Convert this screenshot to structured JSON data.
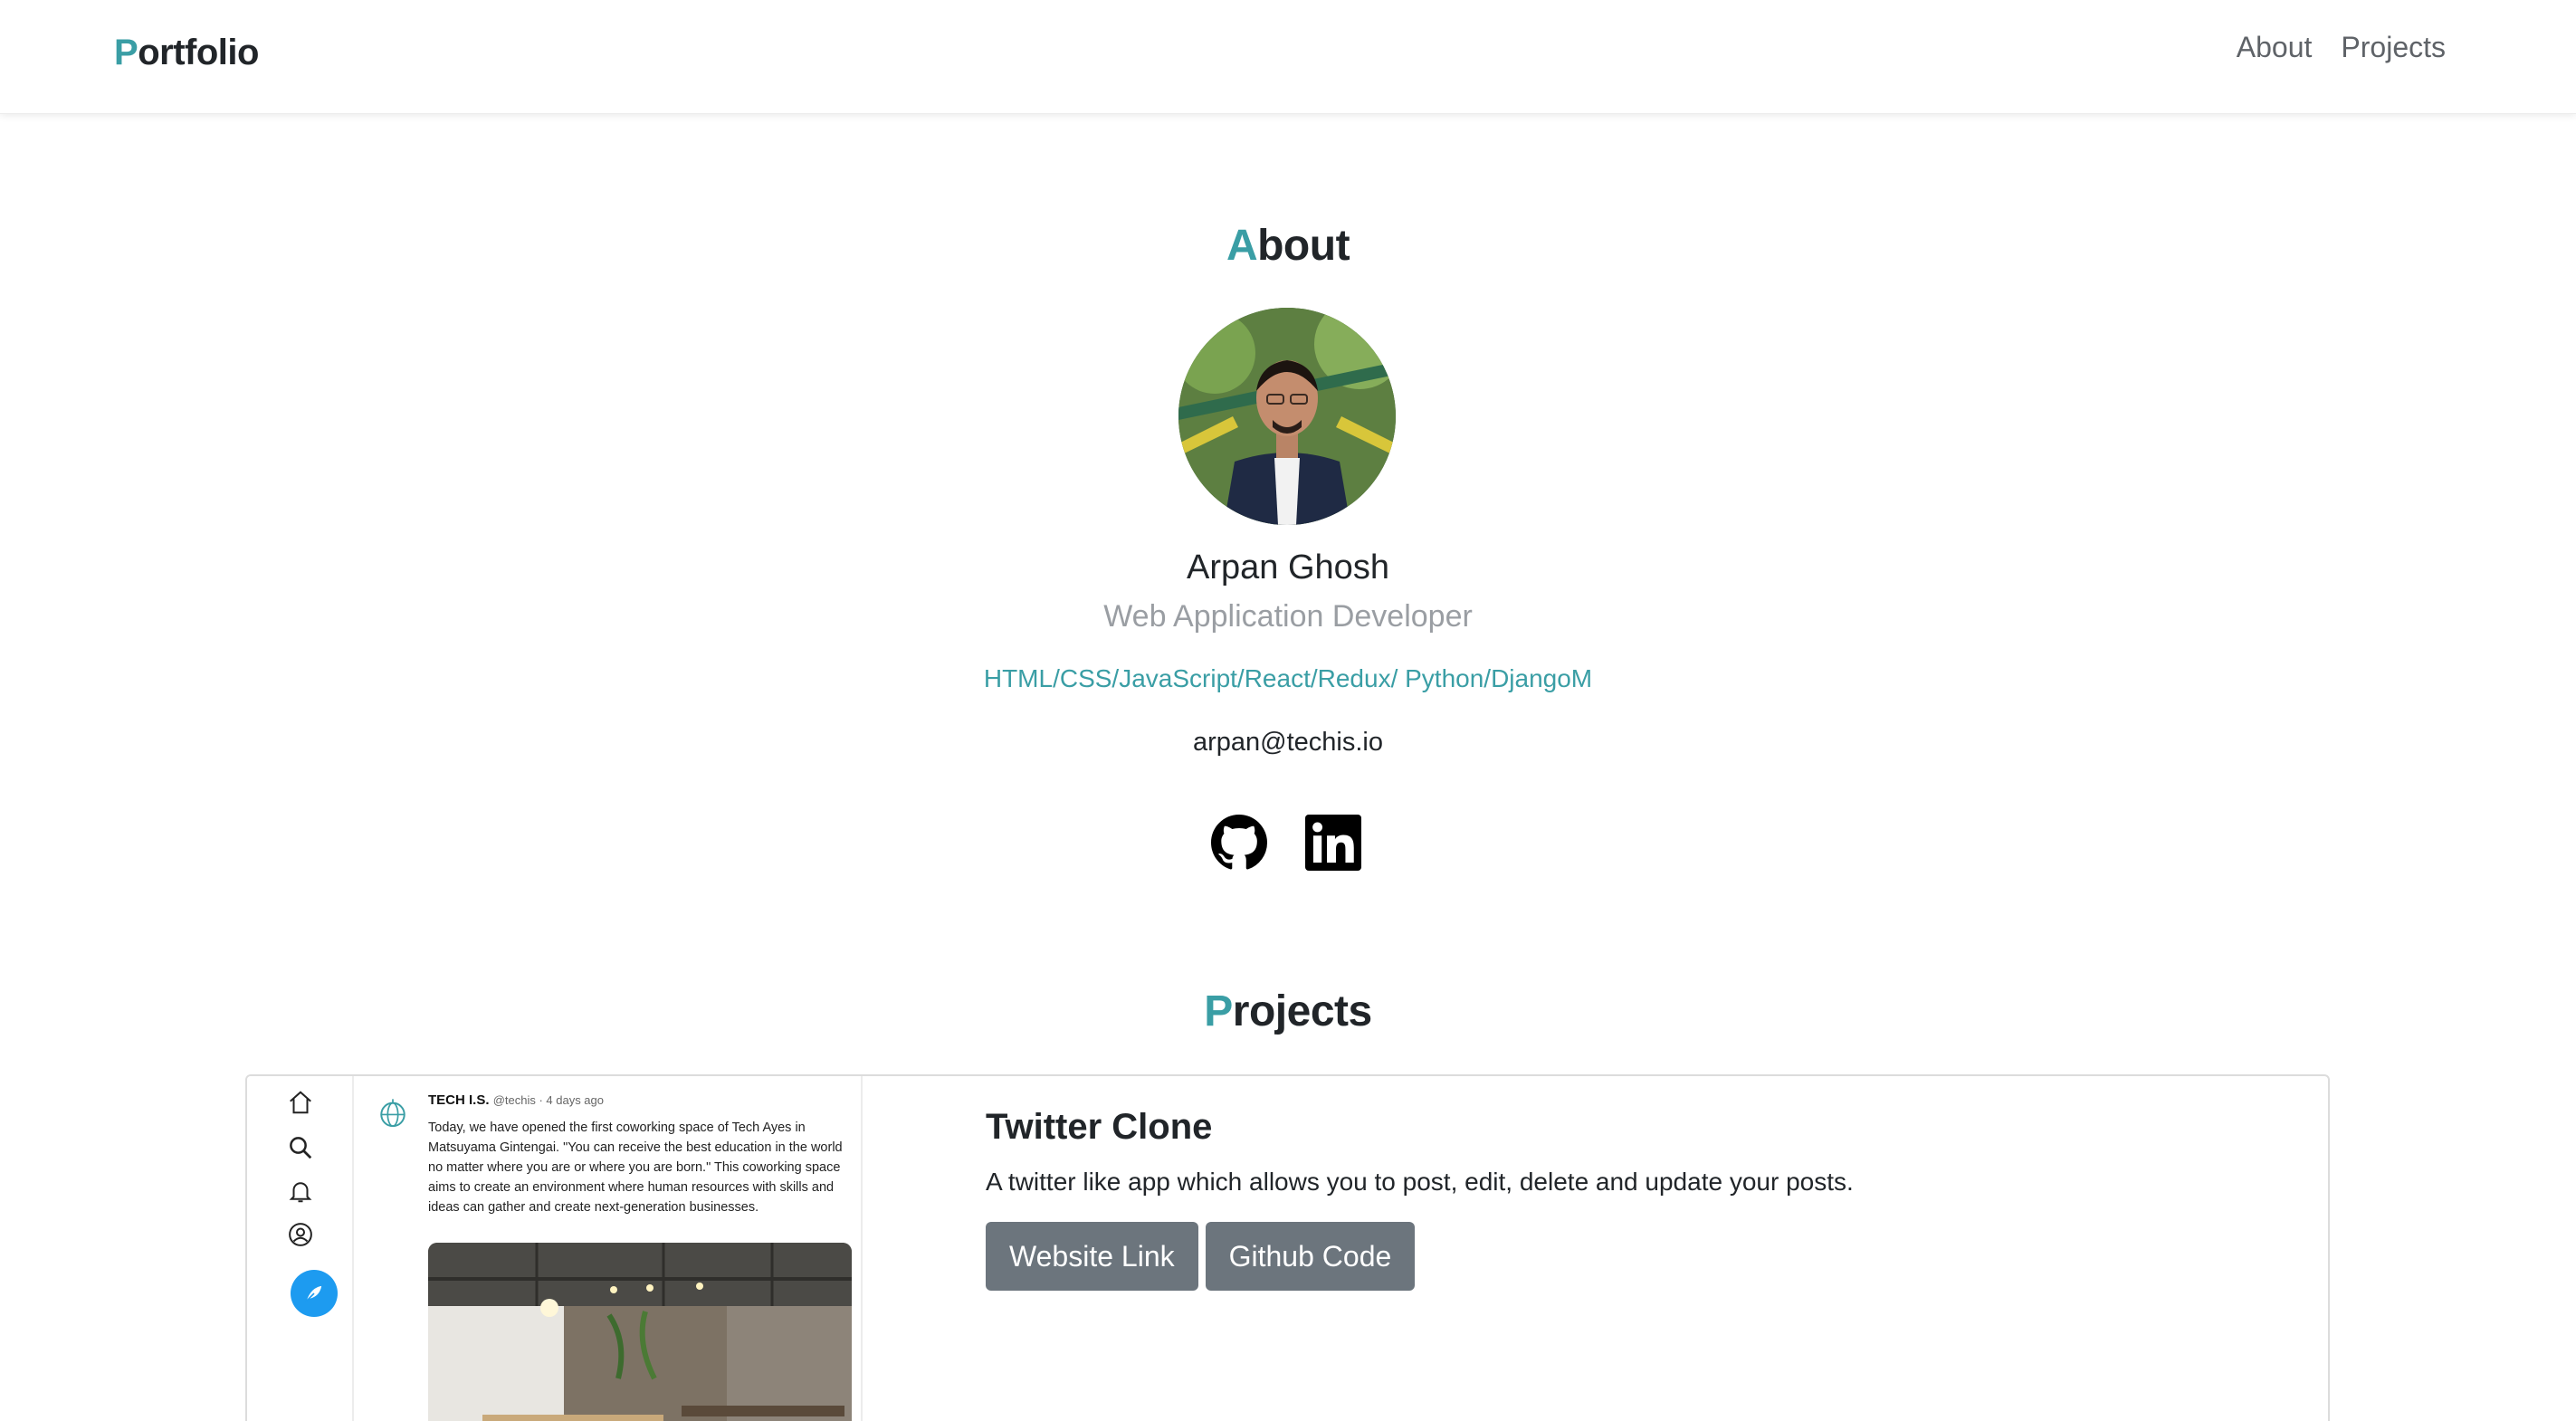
{
  "nav": {
    "brand_first": "P",
    "brand_rest": "ortfolio",
    "links": [
      "About",
      "Projects"
    ]
  },
  "about": {
    "title_first": "A",
    "title_rest": "bout",
    "name": "Arpan Ghosh",
    "role": "Web Application Developer",
    "skills": "HTML/CSS/JavaScript/React/Redux/ Python/DjangoM",
    "email": "arpan@techis.io",
    "socials": [
      "github-icon",
      "linkedin-icon"
    ]
  },
  "projects": {
    "title_first": "P",
    "title_rest": "rojects",
    "items": [
      {
        "title": "Twitter Clone",
        "description": "A twitter like app which allows you to post, edit, delete and update your posts.",
        "website_label": "Website Link",
        "github_label": "Github Code",
        "screenshot": {
          "author": "TECH I.S.",
          "handle_time": "@techis · 4 days ago",
          "text": "Today, we have opened the first coworking space of Tech Ayes in Matsuyama Gintengai. \"You can receive the best education in the world no matter where you are or where you are born.\" This coworking space aims to create an environment where human resources with skills and ideas can gather and create next-generation businesses."
        }
      }
    ]
  },
  "colors": {
    "accent": "#3a9ea5",
    "button": "#6c757d",
    "muted": "#9a9ea3"
  }
}
